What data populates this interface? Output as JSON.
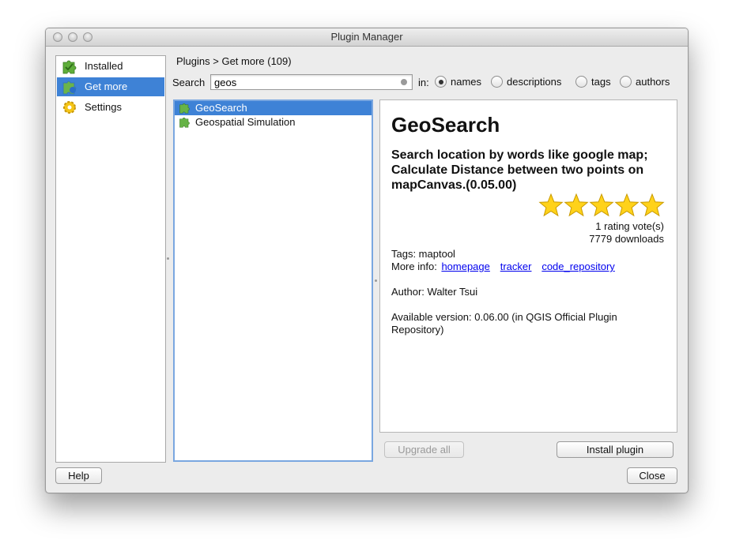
{
  "window": {
    "title": "Plugin Manager"
  },
  "sidebar": {
    "items": [
      {
        "label": "Installed",
        "icon": "puzzle-check-icon",
        "selected": false
      },
      {
        "label": "Get more",
        "icon": "puzzle-blue-icon",
        "selected": true
      },
      {
        "label": "Settings",
        "icon": "gear-icon",
        "selected": false
      }
    ]
  },
  "breadcrumb": "Plugins > Get more (109)",
  "search": {
    "label": "Search",
    "value": "geos",
    "in_label": "in:",
    "options": [
      {
        "label": "names",
        "checked": true
      },
      {
        "label": "descriptions",
        "checked": false
      },
      {
        "label": "tags",
        "checked": false
      },
      {
        "label": "authors",
        "checked": false
      }
    ]
  },
  "plugin_list": [
    {
      "name": "GeoSearch",
      "selected": true
    },
    {
      "name": "Geospatial Simulation",
      "selected": false
    }
  ],
  "details": {
    "title": "GeoSearch",
    "description": "Search location by words like google map; Calculate Distance between two points on mapCanvas.(0.05.00)",
    "rating_stars": 5,
    "votes": "1 rating vote(s)",
    "downloads": "7779 downloads",
    "tags": "Tags: maptool",
    "more_info_label": "More info:",
    "links": [
      "homepage",
      "tracker",
      "code_repository"
    ],
    "author": "Author: Walter Tsui",
    "available_version": "Available version: 0.06.00 (in QGIS Official Plugin Repository)"
  },
  "buttons": {
    "upgrade_all": "Upgrade all",
    "install": "Install plugin",
    "help": "Help",
    "close": "Close"
  },
  "colors": {
    "selection": "#3e82d6",
    "star": "#ffd21a",
    "link": "#0000ee"
  }
}
